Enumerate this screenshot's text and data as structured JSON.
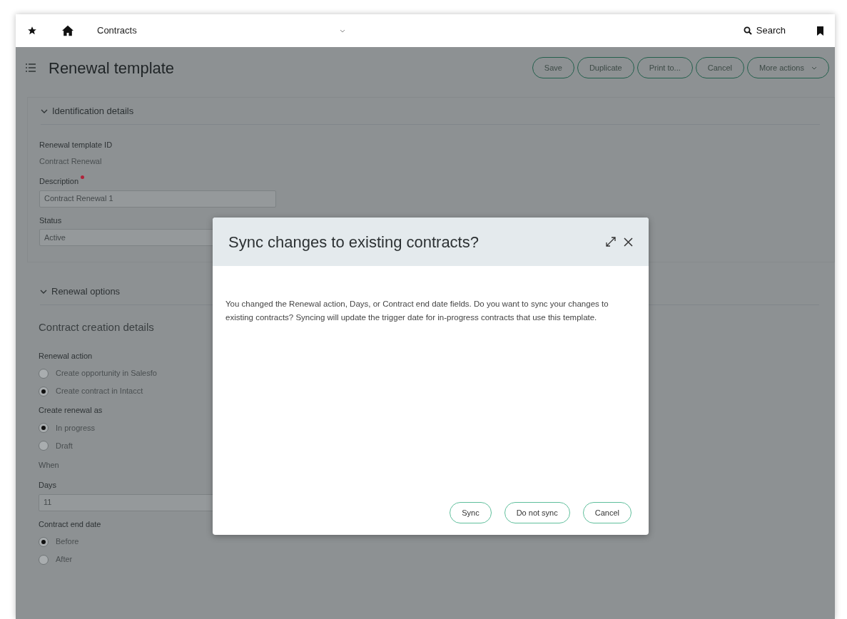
{
  "top_bar": {
    "module": "Contracts",
    "search": "Search"
  },
  "page": {
    "title": "Renewal template",
    "actions": [
      {
        "label": "Save",
        "dropdown": false
      },
      {
        "label": "Duplicate",
        "dropdown": false
      },
      {
        "label": "Print to...",
        "dropdown": false
      },
      {
        "label": "Cancel",
        "dropdown": false
      },
      {
        "label": "More actions",
        "dropdown": true
      }
    ]
  },
  "sections": [
    {
      "title": "Identification details",
      "expanded": true,
      "items": [
        {
          "kind": "readonly",
          "label": "Renewal template ID",
          "value": "Contract Renewal"
        },
        {
          "kind": "input",
          "label": "Description",
          "required": true,
          "value": "Contract Renewal 1"
        },
        {
          "kind": "select",
          "label": "Status",
          "required": false,
          "value": "Active"
        }
      ]
    },
    {
      "title": "Renewal options",
      "expanded": true,
      "items": [
        {
          "kind": "subheading",
          "label": "Contract creation details"
        },
        {
          "kind": "radio",
          "label": "Renewal action",
          "options": [
            {
              "label": "Create opportunity in Salesfo",
              "selected": false
            },
            {
              "label": "Create contract in Intacct",
              "selected": true
            }
          ]
        },
        {
          "kind": "radio",
          "label": "Create renewal as",
          "options": [
            {
              "label": "In progress",
              "selected": true
            },
            {
              "label": "Draft",
              "selected": false
            }
          ]
        },
        {
          "kind": "caption",
          "label": "When"
        },
        {
          "kind": "input",
          "label": "Days",
          "required": false,
          "value": "11"
        },
        {
          "kind": "radio",
          "label": "Contract end date",
          "options": [
            {
              "label": "Before",
              "selected": true
            },
            {
              "label": "After",
              "selected": false
            }
          ]
        }
      ]
    }
  ],
  "dialog": {
    "title": "Sync changes to existing contracts?",
    "message": "You changed the Renewal action, Days, or Contract end date fields. Do you want to sync your changes to existing contracts? Syncing will update the trigger date for in-progress contracts that use this template.",
    "buttons": [
      "Sync",
      "Do not sync",
      "Cancel"
    ]
  }
}
